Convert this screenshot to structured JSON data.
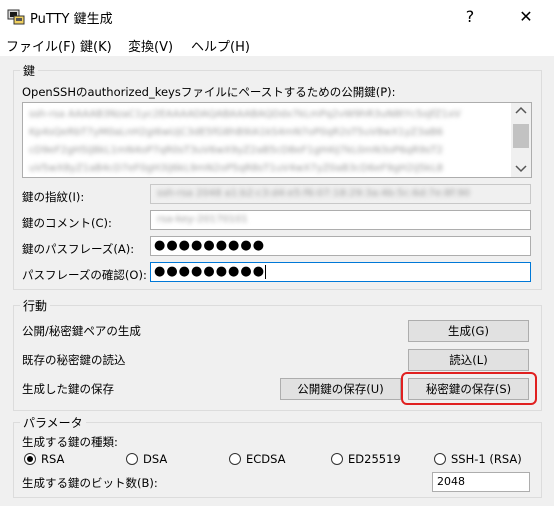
{
  "window": {
    "title": "PuTTY 鍵生成",
    "help_glyph": "?",
    "close_glyph": "✕"
  },
  "menu": [
    "ファイル(F)",
    "鍵(K)",
    "変換(V)",
    "ヘルプ(H)"
  ],
  "key_section": {
    "legend": "鍵",
    "public_key_label": "OpenSSHのauthorized_keysファイルにペーストするための公開鍵(P):",
    "public_key_lines": [
      "ssh-rsa AAAAB3NzaC1yc2EAAAADAQABAAABAQDdx7kLmPq2vW9hR3uN8tYc5oJfZ1xV",
      "Kp4sQeRbT7yM0aLnH2gI6wUjC3dE5fG8hB9iA1kS4mN7oP0qR2sT5uV8wX1yZ3aB6",
      "cD9eF2gH5iJ8kL1mN4oP7qR0sT3uV6wX9yZ2aB5cD8eF1gH4iJ7kL0mN3oP6qR9sT2",
      "uV5wX8yZ1aB4cD7eF0gH3iJ6kL9mN2oP5qR8sT1uV4wX7yZ0aB3cD6eF9gH2iJ5kL8"
    ],
    "fingerprint_label": "鍵の指紋(I):",
    "fingerprint_value": "ssh-rsa 2048 a1:b2:c3:d4:e5:f6:07:18:29:3a:4b:5c:6d:7e:8f:90",
    "comment_label": "鍵のコメント(C):",
    "comment_value": "rsa-key-20170101",
    "passphrase_label": "鍵のパスフレーズ(A):",
    "passphrase_value": "●●●●●●●●●",
    "confirm_label": "パスフレーズの確認(O):",
    "confirm_value": "●●●●●●●●●"
  },
  "actions_section": {
    "legend": "行動",
    "generate_label": "公開/秘密鍵ペアの生成",
    "generate_button": "生成(G)",
    "load_label": "既存の秘密鍵の読込",
    "load_button": "読込(L)",
    "save_label": "生成した鍵の保存",
    "save_public_button": "公開鍵の保存(U)",
    "save_private_button": "秘密鍵の保存(S)"
  },
  "params_section": {
    "legend": "パラメータ",
    "key_type_label": "生成する鍵の種類:",
    "key_types": [
      "RSA",
      "DSA",
      "ECDSA",
      "ED25519",
      "SSH-1 (RSA)"
    ],
    "selected_key_type": "RSA",
    "bits_label": "生成する鍵のビット数(B):",
    "bits_value": "2048"
  },
  "colors": {
    "highlight": "#e02020",
    "focus_border": "#0078d7"
  }
}
